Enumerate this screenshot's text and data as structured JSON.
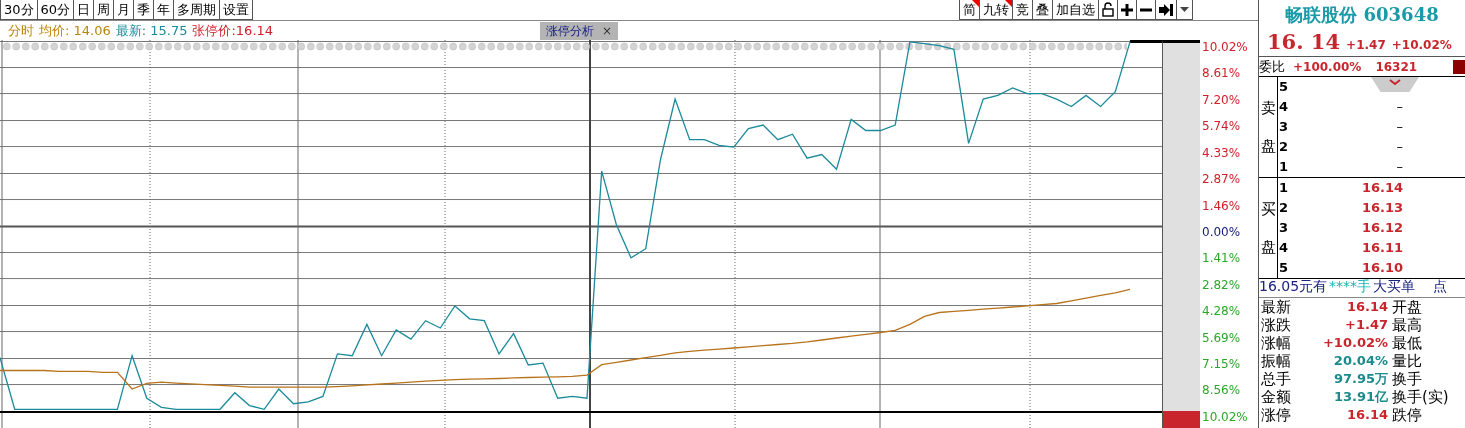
{
  "toolbar": {
    "period_buttons": [
      {
        "label": "30分"
      },
      {
        "label": "60分"
      },
      {
        "label": "日"
      },
      {
        "label": "周"
      },
      {
        "label": "月"
      },
      {
        "label": "季"
      },
      {
        "label": "年"
      },
      {
        "label": "多周期"
      },
      {
        "label": "设置"
      }
    ],
    "tool_buttons": [
      {
        "kind": "text",
        "label": "简",
        "flagged": true
      },
      {
        "kind": "text",
        "label": "九转",
        "flagged": true
      },
      {
        "kind": "text",
        "label": "竞",
        "flagged": false
      },
      {
        "kind": "text",
        "label": "叠",
        "flagged": false
      },
      {
        "kind": "text",
        "label": "加自选",
        "flagged": false
      },
      {
        "kind": "lock"
      },
      {
        "kind": "plus"
      },
      {
        "kind": "minus"
      },
      {
        "kind": "skip"
      },
      {
        "kind": "dropdown"
      }
    ]
  },
  "legend": [
    {
      "text": "分时",
      "color": "#b8860b"
    },
    {
      "text": "均价: 14.06",
      "color": "#b8860b"
    },
    {
      "text": "最新: 15.75",
      "color": "#1b8a9a"
    },
    {
      "text": "张停价:16.14",
      "color": "#d0202a"
    }
  ],
  "tab": {
    "label": "涨停分析",
    "close": "×"
  },
  "chart": {
    "chart_data": {
      "type": "line",
      "ylim": [
        -10.02,
        10.02
      ],
      "yticks": [
        {
          "value": 10.02,
          "label": "10.02%"
        },
        {
          "value": 8.61,
          "label": "8.61%"
        },
        {
          "value": 7.2,
          "label": "7.20%"
        },
        {
          "value": 5.74,
          "label": "5.74%"
        },
        {
          "value": 4.33,
          "label": "4.33%"
        },
        {
          "value": 2.87,
          "label": "2.87%"
        },
        {
          "value": 1.46,
          "label": "1.46%"
        },
        {
          "value": 0,
          "label": "0.00%"
        },
        {
          "value": -1.41,
          "label": "1.41%"
        },
        {
          "value": -2.82,
          "label": "2.82%"
        },
        {
          "value": -4.28,
          "label": "4.28%"
        },
        {
          "value": -5.69,
          "label": "5.69%"
        },
        {
          "value": -7.15,
          "label": "7.15%"
        },
        {
          "value": -8.56,
          "label": "8.56%"
        },
        {
          "value": -10.02,
          "label": "10.02%"
        }
      ],
      "series": [
        {
          "color": "#1b8a9a",
          "values": [
            -7.1,
            -9.9,
            -9.9,
            -9.9,
            -9.9,
            -9.9,
            -9.9,
            -9.9,
            -9.9,
            -7.0,
            -9.3,
            -9.8,
            -9.9,
            -9.9,
            -9.9,
            -9.9,
            -9.0,
            -9.7,
            -9.9,
            -8.8,
            -9.6,
            -9.5,
            -9.2,
            -6.9,
            -7.0,
            -5.3,
            -7.0,
            -5.6,
            -6.1,
            -5.1,
            -5.5,
            -4.3,
            -5.0,
            -5.1,
            -6.9,
            -5.8,
            -7.5,
            -7.4,
            -9.3,
            -9.2,
            -9.3,
            3.0,
            0.1,
            -1.7,
            -1.2,
            3.6,
            6.9,
            4.7,
            4.7,
            4.4,
            4.3,
            5.3,
            5.5,
            4.7,
            5.0,
            3.7,
            3.9,
            3.1,
            5.8,
            5.2,
            5.2,
            5.5,
            10.0,
            9.9,
            9.8,
            9.6,
            4.5,
            6.9,
            7.1,
            7.5,
            7.2,
            7.2,
            6.9,
            6.5,
            7.1,
            6.5,
            7.3,
            10.0
          ]
        },
        {
          "color": "#b8731c",
          "values": [
            -7.8,
            -7.8,
            -7.8,
            -7.8,
            -7.85,
            -7.85,
            -7.85,
            -7.9,
            -7.9,
            -8.8,
            -8.5,
            -8.43,
            -8.48,
            -8.52,
            -8.57,
            -8.6,
            -8.65,
            -8.7,
            -8.7,
            -8.7,
            -8.7,
            -8.7,
            -8.7,
            -8.67,
            -8.63,
            -8.58,
            -8.53,
            -8.48,
            -8.43,
            -8.38,
            -8.33,
            -8.3,
            -8.27,
            -8.25,
            -8.23,
            -8.2,
            -8.18,
            -8.16,
            -8.14,
            -8.12,
            -8.05,
            -7.48,
            -7.36,
            -7.23,
            -7.1,
            -6.98,
            -6.84,
            -6.76,
            -6.7,
            -6.64,
            -6.58,
            -6.52,
            -6.45,
            -6.39,
            -6.33,
            -6.25,
            -6.15,
            -6.04,
            -5.94,
            -5.84,
            -5.74,
            -5.63,
            -5.3,
            -4.87,
            -4.66,
            -4.6,
            -4.54,
            -4.48,
            -4.42,
            -4.36,
            -4.3,
            -4.23,
            -4.17,
            -4.03,
            -3.88,
            -3.73,
            -3.59,
            -3.4
          ]
        }
      ],
      "grid": true
    }
  },
  "quote": {
    "name": "畅联股份",
    "code": "603648",
    "price": "16. 14",
    "change": "+1.47",
    "change_pct": "+10.02%"
  },
  "order_ratio": {
    "label": "委比",
    "ratio": "+100.00%",
    "diff": "16321"
  },
  "sell": {
    "side_label": [
      "卖",
      "盘"
    ],
    "rows": [
      {
        "rank": "5"
      },
      {
        "rank": "4",
        "price": "–"
      },
      {
        "rank": "3",
        "price": "–"
      },
      {
        "rank": "2",
        "price": "–"
      },
      {
        "rank": "1",
        "price": "–"
      }
    ]
  },
  "buy": {
    "side_label": [
      "买",
      "盘"
    ],
    "rows": [
      {
        "rank": "1",
        "price": "16.14"
      },
      {
        "rank": "2",
        "price": "16.13"
      },
      {
        "rank": "3",
        "price": "16.12"
      },
      {
        "rank": "4",
        "price": "16.11"
      },
      {
        "rank": "5",
        "price": "16.10"
      }
    ]
  },
  "big_order": {
    "price": "16.05元有",
    "qty": "****手",
    "label": "大买单",
    "tail": "点"
  },
  "stats": [
    {
      "label": "最新",
      "value": "16.14",
      "color": "#c8252c",
      "label2": "开盘"
    },
    {
      "label": "涨跌",
      "value": "+1.47",
      "color": "#c8252c",
      "label2": "最高"
    },
    {
      "label": "涨幅",
      "value": "+10.02%",
      "color": "#c8252c",
      "label2": "最低"
    },
    {
      "label": "振幅",
      "value": "20.04%",
      "color": "#1a8a8a",
      "label2": "量比"
    },
    {
      "label": "总手",
      "value": "97.95万",
      "color": "#1a8a8a",
      "label2": "换手"
    },
    {
      "label": "金额",
      "value": "13.91亿",
      "color": "#1a8a8a",
      "label2": "换手(实)"
    },
    {
      "label": "涨停",
      "value": "16.14",
      "color": "#c8252c",
      "label2": "跌停"
    }
  ]
}
